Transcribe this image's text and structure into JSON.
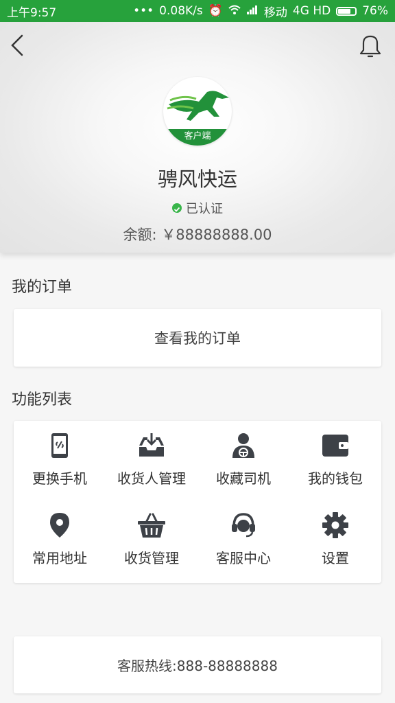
{
  "status": {
    "time": "上午9:57",
    "speed": "0.08K/s",
    "carrier": "移动",
    "network": "4G HD",
    "battery": "76%",
    "battery_level": 0.76
  },
  "header": {
    "logo_text": "客户端",
    "company_name": "骋风快运",
    "verified_label": "已认证",
    "balance_label": "余额:",
    "balance_value": "￥88888888.00"
  },
  "orders": {
    "section_title": "我的订单",
    "view_label": "查看我的订单"
  },
  "functions": {
    "section_title": "功能列表",
    "items": [
      {
        "label": "更换手机",
        "icon": "phone-swap-icon"
      },
      {
        "label": "收货人管理",
        "icon": "inbox-icon"
      },
      {
        "label": "收藏司机",
        "icon": "driver-icon"
      },
      {
        "label": "我的钱包",
        "icon": "wallet-icon"
      },
      {
        "label": "常用地址",
        "icon": "location-pin-icon"
      },
      {
        "label": "收货管理",
        "icon": "basket-icon"
      },
      {
        "label": "客服中心",
        "icon": "headset-icon"
      },
      {
        "label": "设置",
        "icon": "gear-icon"
      }
    ]
  },
  "hotline": {
    "text": "客服热线:888-88888888"
  },
  "colors": {
    "brand_green": "#27a23c",
    "icon_dark": "#3d4147",
    "verified_green": "#39b54a"
  }
}
